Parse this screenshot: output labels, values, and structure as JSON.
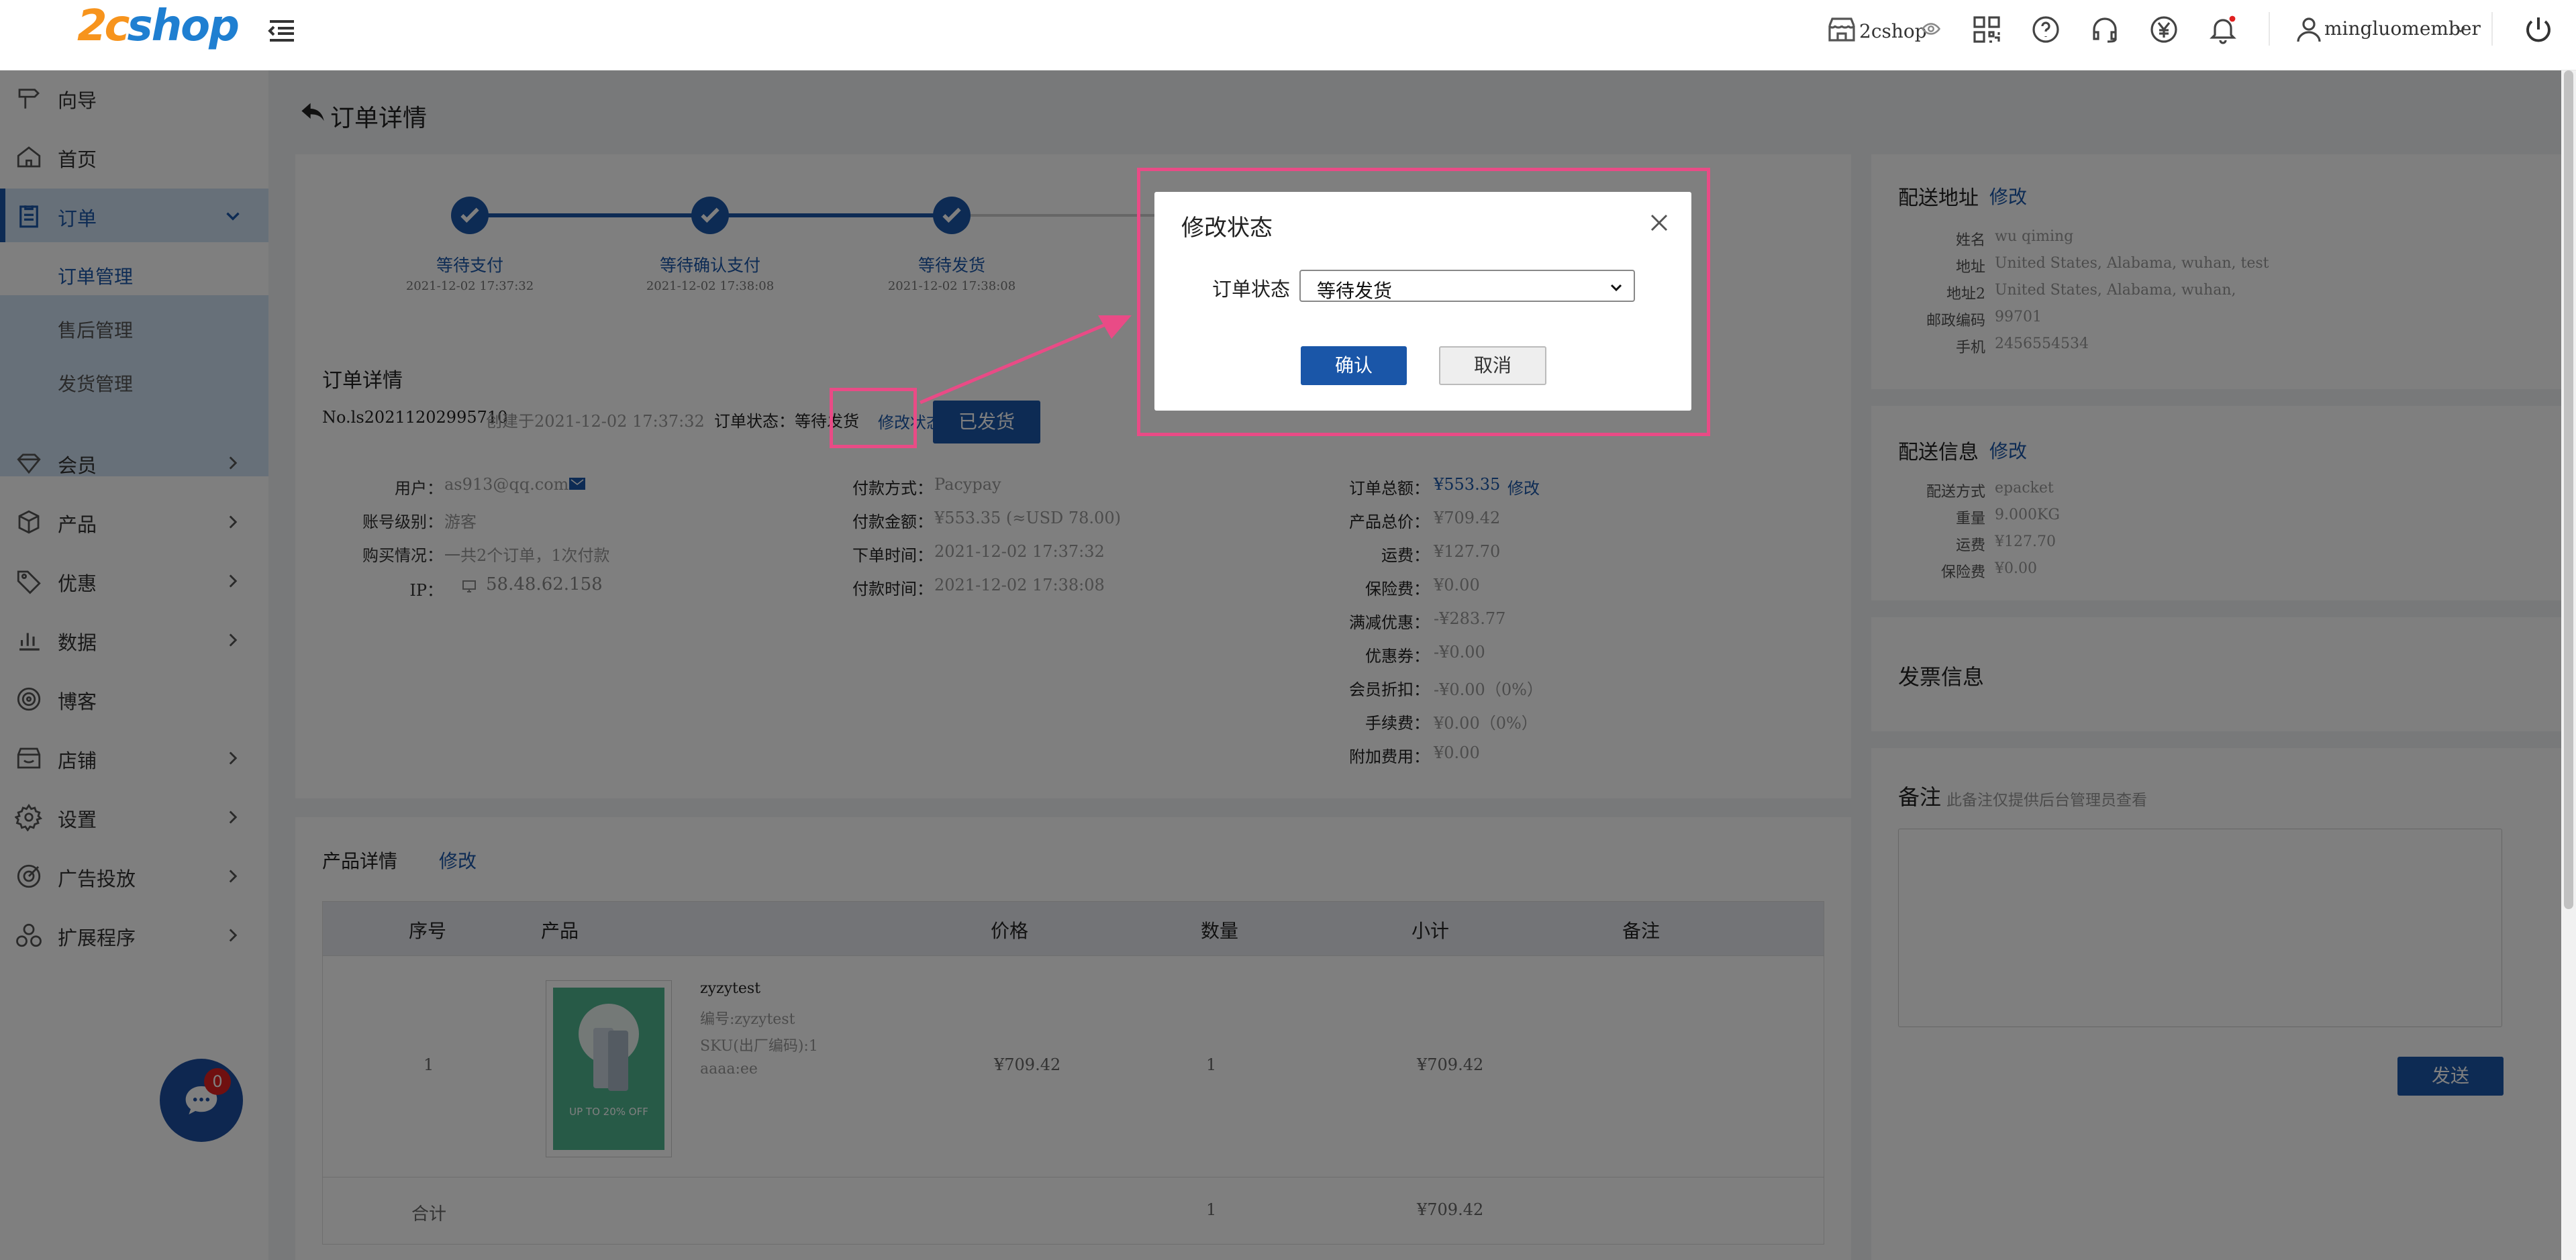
{
  "header": {
    "logo_2c": "2c",
    "logo_shop": "shop",
    "store_name": "2cshop",
    "user_name": "mingluomember"
  },
  "sidebar": {
    "items": [
      {
        "label": "向导",
        "icon": "guide-icon"
      },
      {
        "label": "首页",
        "icon": "home-icon"
      },
      {
        "label": "订单",
        "icon": "order-icon"
      },
      {
        "label": "会员",
        "icon": "member-icon"
      },
      {
        "label": "产品",
        "icon": "product-icon"
      },
      {
        "label": "优惠",
        "icon": "discount-icon"
      },
      {
        "label": "数据",
        "icon": "data-icon"
      },
      {
        "label": "博客",
        "icon": "blog-icon"
      },
      {
        "label": "店铺",
        "icon": "store-icon"
      },
      {
        "label": "设置",
        "icon": "settings-icon"
      },
      {
        "label": "广告投放",
        "icon": "ads-icon"
      },
      {
        "label": "扩展程序",
        "icon": "extensions-icon"
      }
    ],
    "order_sub": [
      "订单管理",
      "售后管理",
      "发货管理"
    ],
    "chat_badge": "0"
  },
  "page": {
    "title": "订单详情"
  },
  "progress": {
    "steps": [
      {
        "label": "等待支付",
        "time": "2021-12-02 17:37:32"
      },
      {
        "label": "等待确认支付",
        "time": "2021-12-02 17:38:08"
      },
      {
        "label": "等待发货",
        "time": "2021-12-02 17:38:08"
      }
    ]
  },
  "order": {
    "section_title": "订单详情",
    "number": "No.ls20211202995710",
    "created": "创建于2021-12-02 17:37:32",
    "status_label": "订单状态：等待发货",
    "modify_status": "修改状态",
    "shipped_button": "已发货",
    "col1": [
      {
        "k": "用户：",
        "v": "as913@qq.com"
      },
      {
        "k": "账号级别：",
        "v": "游客"
      },
      {
        "k": "购买情况：",
        "v": "一共2个订单，1次付款"
      },
      {
        "k": "IP：",
        "v": "58.48.62.158"
      }
    ],
    "col2": [
      {
        "k": "付款方式：",
        "v": "Pacypay"
      },
      {
        "k": "付款金额：",
        "v": "¥553.35 (≈USD 78.00)"
      },
      {
        "k": "下单时间：",
        "v": "2021-12-02 17:37:32"
      },
      {
        "k": "付款时间：",
        "v": "2021-12-02 17:38:08"
      }
    ],
    "total_label": "订单总额：",
    "total_value": "¥553.35",
    "total_modify": "修改",
    "col3": [
      {
        "k": "产品总价：",
        "v": "¥709.42"
      },
      {
        "k": "运费：",
        "v": "¥127.70"
      },
      {
        "k": "保险费：",
        "v": "¥0.00"
      },
      {
        "k": "满减优惠：",
        "v": "-¥283.77"
      },
      {
        "k": "优惠券：",
        "v": "-¥0.00"
      },
      {
        "k": "会员折扣：",
        "v": "-¥0.00（0%）"
      },
      {
        "k": "手续费：",
        "v": "¥0.00（0%）"
      },
      {
        "k": "附加费用：",
        "v": "¥0.00"
      }
    ]
  },
  "products": {
    "section_title": "产品详情",
    "modify": "修改",
    "columns": [
      "序号",
      "产品",
      "价格",
      "数量",
      "小计",
      "备注"
    ],
    "row": {
      "index": "1",
      "name": "zyzytest",
      "code": "编号:zyzytest",
      "sku": "SKU(出厂编码):1",
      "attr": "aaaa:ee",
      "price": "¥709.42",
      "qty": "1",
      "subtotal": "¥709.42",
      "image_text": "UP TO 20% OFF"
    },
    "total_label": "合计",
    "total_qty": "1",
    "total_subtotal": "¥709.42"
  },
  "shipping_address": {
    "title": "配送地址",
    "modify": "修改",
    "rows": [
      {
        "k": "姓名",
        "v": "wu qiming"
      },
      {
        "k": "地址",
        "v": "United States, Alabama, wuhan, test"
      },
      {
        "k": "地址2",
        "v": "United States, Alabama, wuhan,"
      },
      {
        "k": "邮政编码",
        "v": "99701"
      },
      {
        "k": "手机",
        "v": "2456554534"
      }
    ]
  },
  "shipping_info": {
    "title": "配送信息",
    "modify": "修改",
    "rows": [
      {
        "k": "配送方式",
        "v": "epacket"
      },
      {
        "k": "重量",
        "v": "9.000KG"
      },
      {
        "k": "运费",
        "v": "¥127.70"
      },
      {
        "k": "保险费",
        "v": "¥0.00"
      }
    ]
  },
  "invoice": {
    "title": "发票信息"
  },
  "remark": {
    "title": "备注",
    "hint": "此备注仅提供后台管理员查看",
    "send_button": "发送"
  },
  "modal": {
    "title": "修改状态",
    "field_label": "订单状态",
    "selected": "等待发货",
    "confirm": "确认",
    "cancel": "取消"
  },
  "colors": {
    "primary": "#1a56a8",
    "highlight": "#e94b86"
  }
}
